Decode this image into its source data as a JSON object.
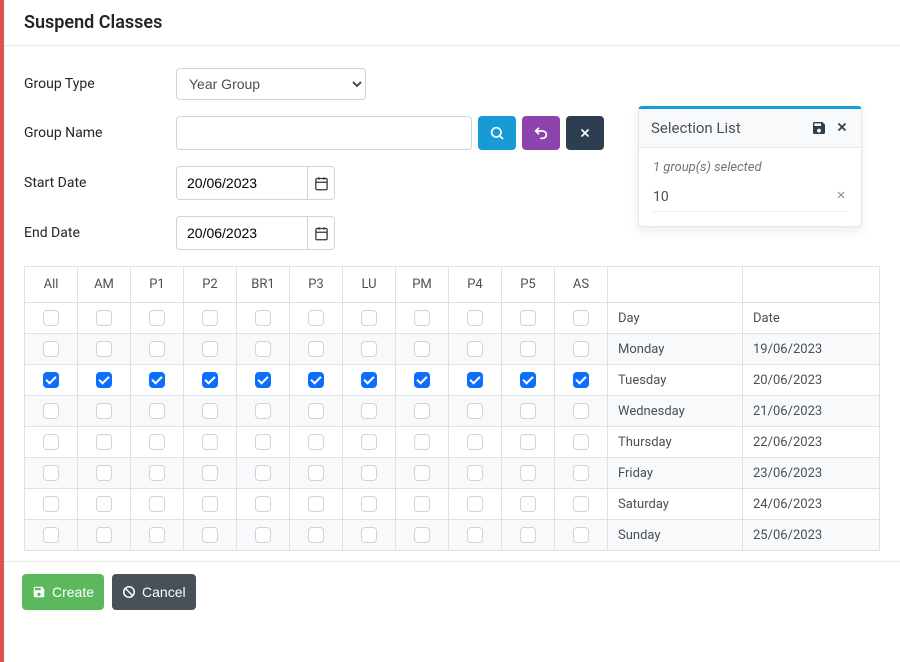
{
  "title": "Suspend Classes",
  "form": {
    "groupType": {
      "label": "Group Type",
      "selected": "Year Group"
    },
    "groupName": {
      "label": "Group Name",
      "value": ""
    },
    "startDate": {
      "label": "Start Date",
      "value": "20/06/2023"
    },
    "endDate": {
      "label": "End Date",
      "value": "20/06/2023"
    }
  },
  "selection": {
    "title": "Selection List",
    "countText": "1 group(s) selected",
    "items": [
      {
        "label": "10"
      }
    ]
  },
  "schedule": {
    "periods": [
      "All",
      "AM",
      "P1",
      "P2",
      "BR1",
      "P3",
      "LU",
      "PM",
      "P4",
      "P5",
      "AS"
    ],
    "dayHeader": "Day",
    "dateHeader": "Date",
    "rows": [
      {
        "day": "Monday",
        "date": "19/06/2023",
        "checked": [
          false,
          false,
          false,
          false,
          false,
          false,
          false,
          false,
          false,
          false,
          false
        ]
      },
      {
        "day": "Tuesday",
        "date": "20/06/2023",
        "checked": [
          true,
          true,
          true,
          true,
          true,
          true,
          true,
          true,
          true,
          true,
          true
        ]
      },
      {
        "day": "Wednesday",
        "date": "21/06/2023",
        "checked": [
          false,
          false,
          false,
          false,
          false,
          false,
          false,
          false,
          false,
          false,
          false
        ]
      },
      {
        "day": "Thursday",
        "date": "22/06/2023",
        "checked": [
          false,
          false,
          false,
          false,
          false,
          false,
          false,
          false,
          false,
          false,
          false
        ]
      },
      {
        "day": "Friday",
        "date": "23/06/2023",
        "checked": [
          false,
          false,
          false,
          false,
          false,
          false,
          false,
          false,
          false,
          false,
          false
        ]
      },
      {
        "day": "Saturday",
        "date": "24/06/2023",
        "checked": [
          false,
          false,
          false,
          false,
          false,
          false,
          false,
          false,
          false,
          false,
          false
        ]
      },
      {
        "day": "Sunday",
        "date": "25/06/2023",
        "checked": [
          false,
          false,
          false,
          false,
          false,
          false,
          false,
          false,
          false,
          false,
          false
        ]
      }
    ]
  },
  "footer": {
    "createLabel": "Create",
    "cancelLabel": "Cancel"
  }
}
